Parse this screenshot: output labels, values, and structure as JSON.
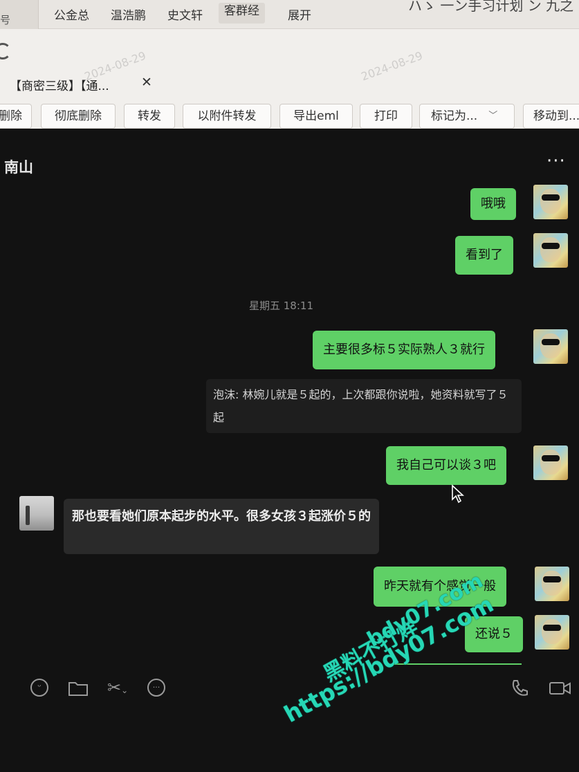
{
  "browser": {
    "tabs": [
      "公金总",
      "温浩鹏",
      "史文轩",
      "客群经",
      "展开"
    ],
    "right_title": "ハゝ 一ン手习计划 ン 九之"
  },
  "email": {
    "subject": "【商密三级】【通...",
    "watermark_dates": [
      "2024-08-29",
      "2024-08-29"
    ],
    "toolbar": [
      "删除",
      "彻底删除",
      "转发",
      "以附件转发",
      "导出eml",
      "打印",
      "标记为...",
      "移动到..."
    ]
  },
  "chat": {
    "contact_name": "南山",
    "more_icon": "···",
    "time_divider": "星期五 18:11",
    "messages": [
      {
        "from": "me",
        "text": "哦哦"
      },
      {
        "from": "me",
        "text": "看到了"
      },
      {
        "from": "me",
        "text": "主要很多标５实际熟人３就行"
      },
      {
        "from": "quote",
        "text": "泡沫: 林婉儿就是５起的，上次都跟你说啦，她资料就写了５起"
      },
      {
        "from": "me",
        "text": "我自己可以谈３吧"
      },
      {
        "from": "other",
        "text": "那也要看她们原本起步的水平。很多女孩３起涨价５的"
      },
      {
        "from": "me",
        "text": "昨天就有个感觉一般"
      },
      {
        "from": "me",
        "text": "还说５"
      }
    ],
    "toolbar_icons": [
      "emoji-icon",
      "folder-icon",
      "scissors-icon",
      "chat-bubble-icon",
      "phone-icon",
      "video-icon"
    ]
  },
  "overlay_watermark": {
    "line1": "黑料不打烊",
    "line2": "bdy07.com",
    "line3": "https://bdy07.com",
    "color": "#26d7b5"
  },
  "colors": {
    "my_bubble": "#5fd066",
    "chat_bg": "#121212",
    "their_bubble": "#2a2a2a"
  }
}
